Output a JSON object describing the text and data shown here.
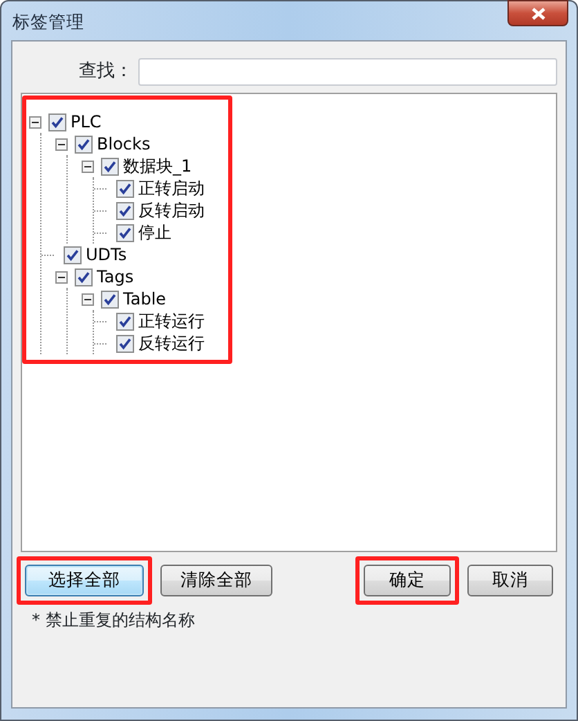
{
  "window": {
    "title": "标签管理"
  },
  "search": {
    "label": "查找："
  },
  "tree": {
    "highlighted": true,
    "nodes": [
      {
        "label": "PLC",
        "checked": true,
        "expanded": true,
        "children": [
          {
            "label": "Blocks",
            "checked": true,
            "expanded": true,
            "children": [
              {
                "label": "数据块_1",
                "checked": true,
                "expanded": true,
                "children": [
                  {
                    "label": "正转启动",
                    "checked": true
                  },
                  {
                    "label": "反转启动",
                    "checked": true
                  },
                  {
                    "label": "停止",
                    "checked": true
                  }
                ]
              }
            ]
          },
          {
            "label": "UDTs",
            "checked": true
          },
          {
            "label": "Tags",
            "checked": true,
            "expanded": true,
            "children": [
              {
                "label": "Table",
                "checked": true,
                "expanded": true,
                "children": [
                  {
                    "label": "正转运行",
                    "checked": true
                  },
                  {
                    "label": "反转运行",
                    "checked": true
                  }
                ]
              }
            ]
          }
        ]
      }
    ]
  },
  "left_buttons": [
    {
      "label": "选择全部",
      "focused": true,
      "highlighted": true
    },
    {
      "label": "清除全部",
      "focused": false,
      "highlighted": false
    }
  ],
  "right_buttons": [
    {
      "label": "确定",
      "focused": false,
      "highlighted": true
    },
    {
      "label": "取消",
      "focused": false,
      "highlighted": false
    }
  ],
  "note": "* 禁止重复的结构名称"
}
